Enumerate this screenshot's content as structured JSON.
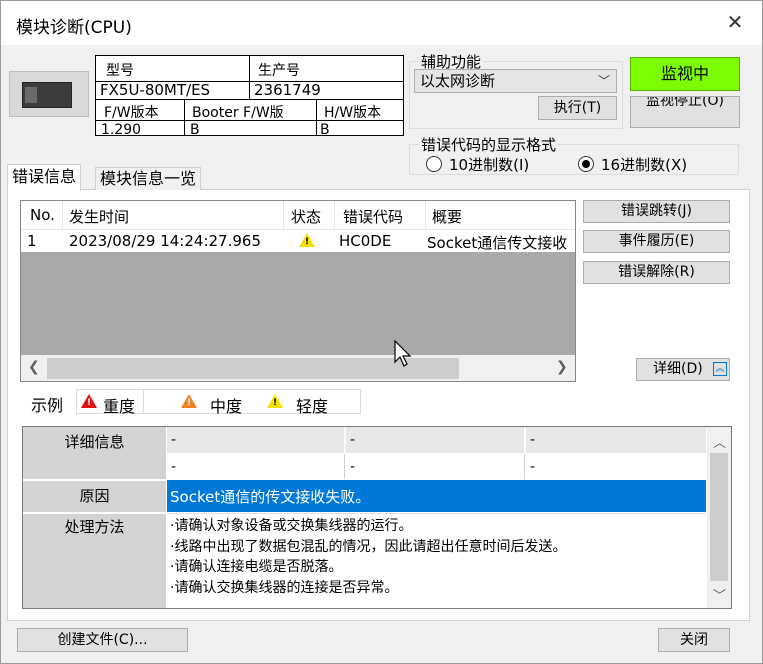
{
  "window": {
    "title": "模块诊断(CPU)"
  },
  "module_info": {
    "model_header": "型号",
    "model_value": "FX5U-80MT/ES",
    "serial_header": "生产号",
    "serial_value": "2361749",
    "fw_header": "F/W版本",
    "fw_value": "1.290",
    "booter_header": "Booter F/W版",
    "booter_value": "B",
    "hw_header": "H/W版本",
    "hw_value": "B"
  },
  "aux": {
    "label": "辅助功能",
    "selected": "以太网诊断",
    "execute_button": "执行(T)"
  },
  "monitor": {
    "status_button": "监视中",
    "stop_button": "监视停止(O)"
  },
  "format": {
    "label": "错误代码的显示格式",
    "opt_dec": "10进制数(I)",
    "opt_hex": "16进制数(X)",
    "selected": "hex"
  },
  "tabs": [
    {
      "label": "错误信息",
      "active": true
    },
    {
      "label": "模块信息一览",
      "active": false
    }
  ],
  "error_list": {
    "columns": [
      "No.",
      "发生时间",
      "状态",
      "错误代码",
      "概要"
    ],
    "rows": [
      {
        "no": "1",
        "time": "2023/08/29 14:24:27.965",
        "status": "warning-minor",
        "code": "HC0DE",
        "summary": "Socket通信传文接收"
      }
    ]
  },
  "side_buttons": {
    "jump": "错误跳转(J)",
    "history": "事件履历(E)",
    "clear": "错误解除(R)",
    "detail": "详细(D)"
  },
  "legend": {
    "label": "示例",
    "major": "重度",
    "moderate": "中度",
    "minor": "轻度"
  },
  "detail": {
    "info_label": "详细信息",
    "info_rows": [
      [
        "-",
        "-",
        "-"
      ],
      [
        "-",
        "-",
        "-"
      ]
    ],
    "cause_label": "原因",
    "cause_text": "Socket通信的传文接收失败。",
    "action_label": "处理方法",
    "action_lines": [
      "·请确认对象设备或交换集线器的运行。",
      "·线路中出现了数据包混乱的情况，因此请超出任意时间后发送。",
      "·请确认连接电缆是否脱落。",
      "·请确认交换集线器的连接是否异常。"
    ]
  },
  "footer": {
    "create_file": "创建文件(C)...",
    "close": "关闭"
  },
  "colors": {
    "monitor_green": "#7cfc00",
    "selection_blue": "#0078d7",
    "warn_red": "#e01010",
    "warn_orange": "#f08020",
    "warn_yellow": "#f5e000"
  }
}
